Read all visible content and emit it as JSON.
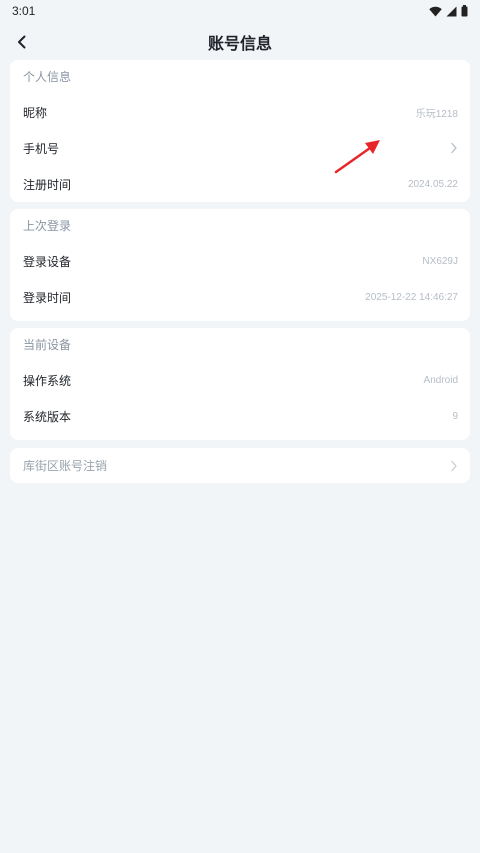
{
  "status_bar": {
    "time": "3:01"
  },
  "header": {
    "title": "账号信息"
  },
  "personal_info": {
    "title": "个人信息",
    "rows": [
      {
        "label": "昵称",
        "value": "乐玩1218"
      },
      {
        "label": "手机号",
        "value": ""
      },
      {
        "label": "注册时间",
        "value": "2024.05.22"
      }
    ]
  },
  "last_login": {
    "title": "上次登录",
    "rows": [
      {
        "label": "登录设备",
        "value": "NX629J"
      },
      {
        "label": "登录时间",
        "value": "2025-12-22 14:46:27"
      }
    ]
  },
  "current_device": {
    "title": "当前设备",
    "rows": [
      {
        "label": "操作系统",
        "value": "Android"
      },
      {
        "label": "系统版本",
        "value": "9"
      }
    ]
  },
  "deregister": {
    "label": "库街区账号注销"
  },
  "colors": {
    "background": "#f2f5f8",
    "card": "#ffffff",
    "section_title": "#8a95a3",
    "value_text": "#b6bdc6",
    "annotation_arrow": "#e8262a"
  }
}
